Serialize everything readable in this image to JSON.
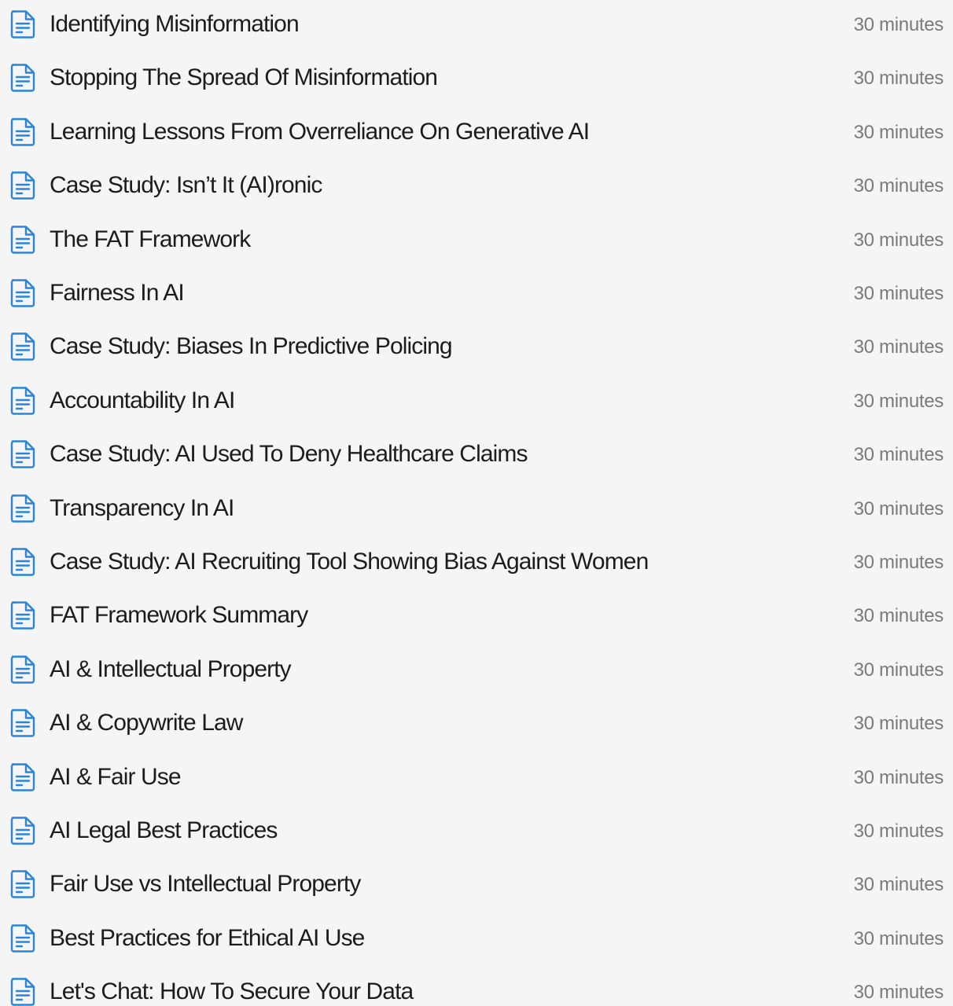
{
  "icon_name": "document-icon",
  "accent_color": "#2a84d8",
  "lessons": [
    {
      "title": "Identifying Misinformation",
      "duration": "30 minutes"
    },
    {
      "title": "Stopping The Spread Of Misinformation",
      "duration": "30 minutes"
    },
    {
      "title": "Learning Lessons From Overreliance On Generative AI",
      "duration": "30 minutes"
    },
    {
      "title": "Case Study: Isn’t It (AI)ronic",
      "duration": "30 minutes"
    },
    {
      "title": "The FAT Framework",
      "duration": "30 minutes"
    },
    {
      "title": "Fairness In AI",
      "duration": "30 minutes"
    },
    {
      "title": "Case Study: Biases In Predictive Policing",
      "duration": "30 minutes"
    },
    {
      "title": "Accountability In AI",
      "duration": "30 minutes"
    },
    {
      "title": "Case Study: AI Used To Deny Healthcare Claims",
      "duration": "30 minutes"
    },
    {
      "title": "Transparency In AI",
      "duration": "30 minutes"
    },
    {
      "title": "Case Study: AI Recruiting Tool Showing Bias Against Women",
      "duration": "30 minutes"
    },
    {
      "title": "FAT Framework Summary",
      "duration": "30 minutes"
    },
    {
      "title": "AI & Intellectual Property",
      "duration": "30 minutes"
    },
    {
      "title": "AI & Copywrite Law",
      "duration": "30 minutes"
    },
    {
      "title": "AI & Fair Use",
      "duration": "30 minutes"
    },
    {
      "title": "AI Legal Best Practices",
      "duration": "30 minutes"
    },
    {
      "title": "Fair Use vs Intellectual Property",
      "duration": "30 minutes"
    },
    {
      "title": "Best Practices for Ethical AI Use",
      "duration": "30 minutes"
    },
    {
      "title": "Let's Chat: How To Secure Your Data",
      "duration": "30 minutes"
    }
  ]
}
